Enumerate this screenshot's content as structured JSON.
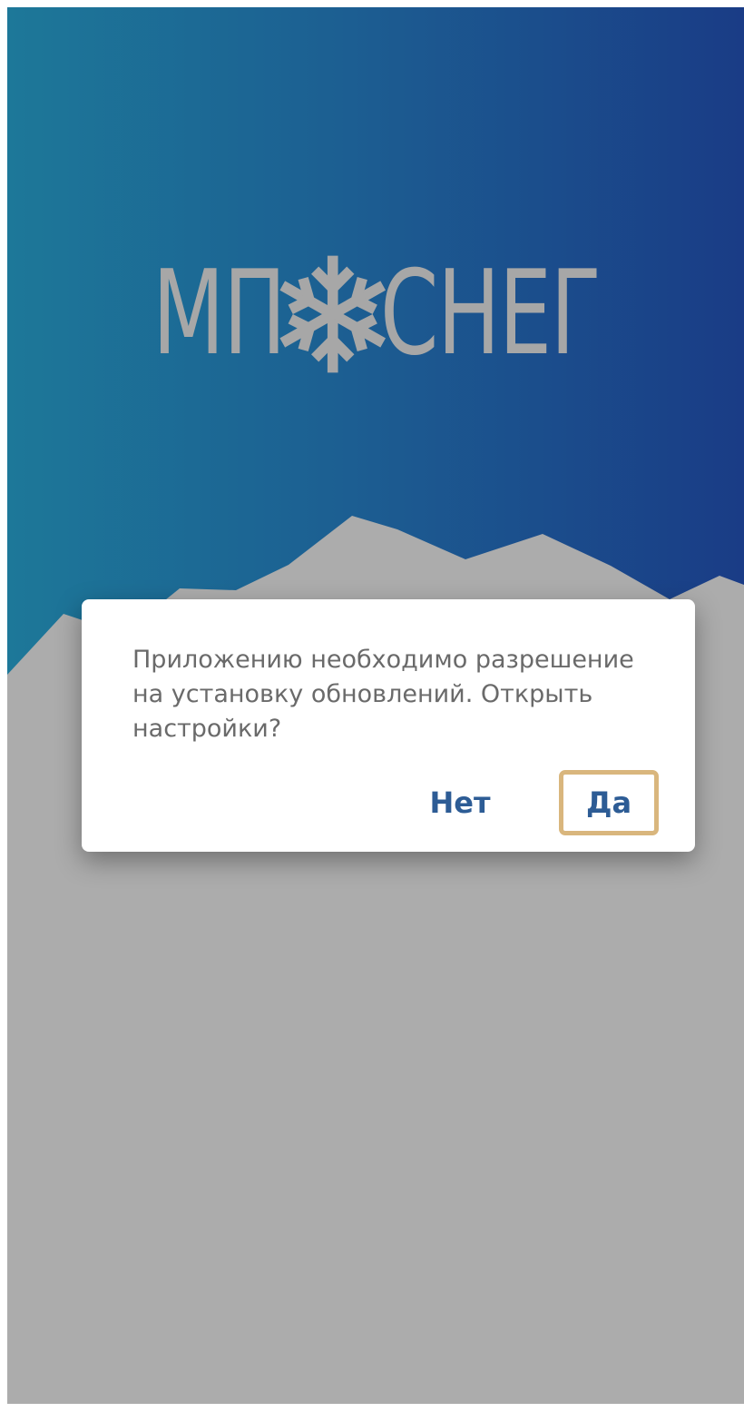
{
  "app": {
    "logo_left": "МП",
    "logo_right": "СНЕГ",
    "logo_icon": "snowflake-icon"
  },
  "dialog": {
    "message": "Приложению необходимо разрешение на установку обновлений. Открыть настройки?",
    "no_label": "Нет",
    "yes_label": "Да"
  },
  "colors": {
    "sky_left": "#1d7899",
    "sky_right": "#1a3c86",
    "mountains": "#acacac",
    "logo": "#a7a7a7",
    "button_text": "#2d5c95",
    "highlight": "#d9b67d"
  }
}
